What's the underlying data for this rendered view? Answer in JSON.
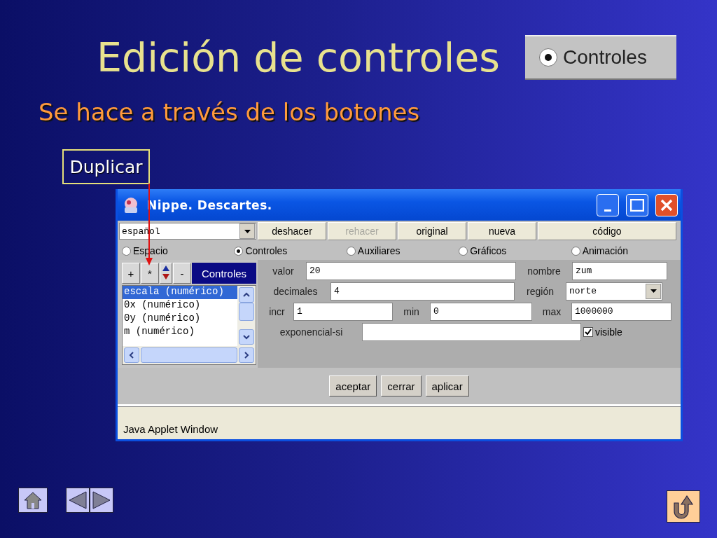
{
  "slide": {
    "title": "Edición de controles",
    "badge": {
      "label": "Controles",
      "selected": true
    },
    "subtitle": "Se hace a través de los botones",
    "callout": "Duplicar"
  },
  "window": {
    "title": "Nippe. Descartes.",
    "language": "español",
    "toolbar": [
      {
        "label": "deshacer",
        "disabled": false
      },
      {
        "label": "rehacer",
        "disabled": true
      },
      {
        "label": "original",
        "disabled": false
      },
      {
        "label": "nueva",
        "disabled": false
      },
      {
        "label": "código",
        "disabled": false
      }
    ],
    "tabs": [
      {
        "label": "Espacio",
        "selected": false
      },
      {
        "label": "Controles",
        "selected": true
      },
      {
        "label": "Auxiliares",
        "selected": false
      },
      {
        "label": "Gráficos",
        "selected": false
      },
      {
        "label": "Animación",
        "selected": false
      }
    ],
    "list_buttons": [
      {
        "kind": "button",
        "label": "+"
      },
      {
        "kind": "button",
        "label": "*"
      },
      {
        "kind": "updown"
      },
      {
        "kind": "button",
        "label": "-"
      }
    ],
    "list_header": "Controles",
    "list_items": [
      {
        "label": "escala (numérico)",
        "selected": true
      },
      {
        "label": "0x (numérico)",
        "selected": false
      },
      {
        "label": "0y (numérico)",
        "selected": false
      },
      {
        "label": "m (numérico)",
        "selected": false
      }
    ],
    "form": [
      [
        {
          "kind": "label",
          "text": "valor"
        },
        {
          "kind": "field",
          "value": "20"
        },
        {
          "kind": "label",
          "text": "nombre"
        },
        {
          "kind": "field",
          "value": "zum"
        }
      ],
      [
        {
          "kind": "label",
          "text": "decimales"
        },
        {
          "kind": "field",
          "value": "4"
        },
        {
          "kind": "label",
          "text": "región"
        },
        {
          "kind": "select",
          "value": "norte"
        }
      ],
      [
        {
          "kind": "label",
          "text": "incr"
        },
        {
          "kind": "field",
          "value": "1"
        },
        {
          "kind": "label",
          "text": "min"
        },
        {
          "kind": "field",
          "value": "0"
        },
        {
          "kind": "label",
          "text": "max"
        },
        {
          "kind": "field",
          "value": "1000000"
        }
      ],
      [
        {
          "kind": "label",
          "text": "exponencial-si"
        },
        {
          "kind": "field"
        },
        {
          "kind": "checkbox",
          "label": "visible",
          "checked": true
        }
      ]
    ],
    "buttons": [
      "aceptar",
      "cerrar",
      "aplicar"
    ],
    "status": "Java Applet Window"
  }
}
